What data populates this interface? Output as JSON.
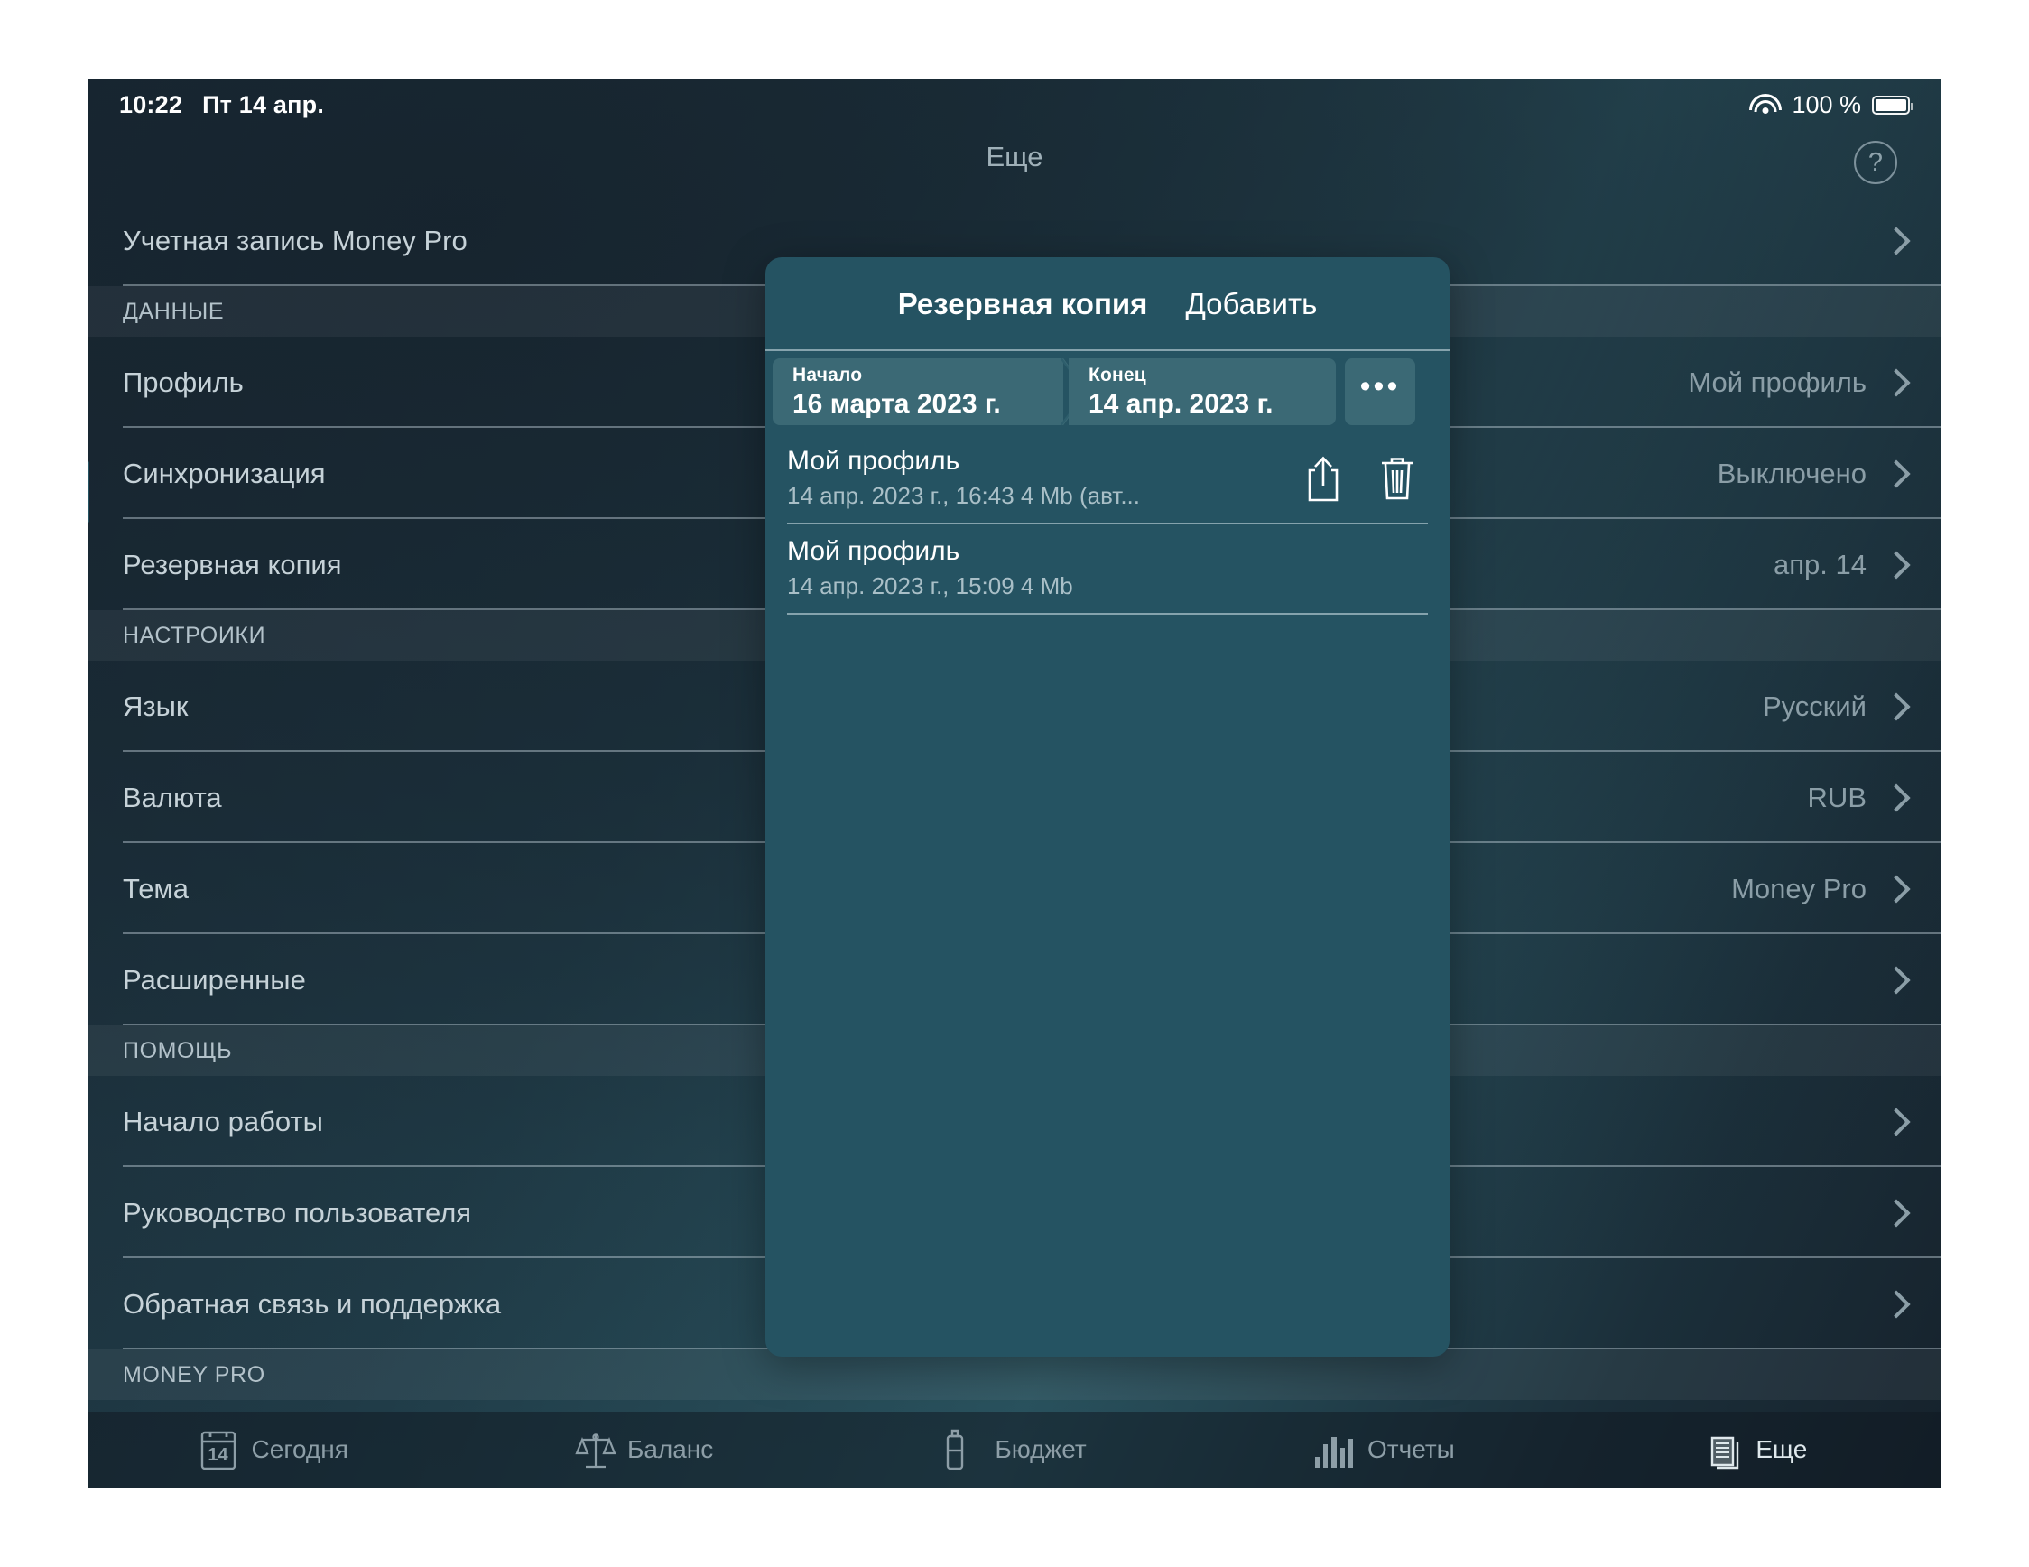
{
  "statusbar": {
    "time": "10:22",
    "date": "Пт 14 апр.",
    "battery_percent": "100 %",
    "wifi_icon": "wifi-icon",
    "battery_icon": "battery-full-icon"
  },
  "header": {
    "title": "Еще",
    "help_icon": "question-mark-icon"
  },
  "settings": {
    "rows": [
      {
        "type": "row",
        "label": "Учетная запись Money Pro",
        "value": ""
      },
      {
        "type": "section",
        "label": "ДАННЫЕ"
      },
      {
        "type": "row",
        "label": "Профиль",
        "value": "Мой профиль"
      },
      {
        "type": "row",
        "label": "Синхронизация",
        "value": "Выключено"
      },
      {
        "type": "row",
        "label": "Резервная копия",
        "value": "апр. 14"
      },
      {
        "type": "section",
        "label": "НАСТРОИКИ"
      },
      {
        "type": "row",
        "label": "Язык",
        "value": "Русский"
      },
      {
        "type": "row",
        "label": "Валюта",
        "value": "RUB"
      },
      {
        "type": "row",
        "label": "Тема",
        "value": "Money Pro"
      },
      {
        "type": "row",
        "label": "Расширенные",
        "value": ""
      },
      {
        "type": "section",
        "label": "ПОМОЩЬ"
      },
      {
        "type": "row",
        "label": "Начало работы",
        "value": ""
      },
      {
        "type": "row",
        "label": "Руководство пользователя",
        "value": ""
      },
      {
        "type": "row",
        "label": "Обратная связь и поддержка",
        "value": ""
      },
      {
        "type": "section",
        "label": "MONEY PRO"
      }
    ]
  },
  "popover": {
    "title": "Резервная копия",
    "add_label": "Добавить",
    "range": {
      "start_caption": "Начало",
      "start_value": "16 марта 2023 г.",
      "end_caption": "Конец",
      "end_value": "14 апр. 2023 г.",
      "more_label": "•••",
      "more_icon": "ellipsis-icon"
    },
    "backups": [
      {
        "name": "Мой профиль",
        "meta": "14 апр. 2023 г., 16:43 4 Mb  (авт...",
        "share_icon": "share-icon",
        "delete_icon": "trash-icon",
        "has_actions": true
      },
      {
        "name": "Мой профиль",
        "meta": "14 апр. 2023 г., 15:09 4 Mb",
        "has_actions": false
      }
    ]
  },
  "tabbar": {
    "tabs": [
      {
        "label": "Сегодня",
        "icon": "calendar-icon",
        "day": "14",
        "active": false
      },
      {
        "label": "Баланс",
        "icon": "scales-icon",
        "active": false
      },
      {
        "label": "Бюджет",
        "icon": "budget-icon",
        "active": false
      },
      {
        "label": "Отчеты",
        "icon": "bar-chart-icon",
        "active": false
      },
      {
        "label": "Еще",
        "icon": "documents-icon",
        "active": true
      }
    ]
  },
  "colors": {
    "popover_bg": "#255362",
    "segment_bg": "#3b6975",
    "page_bg_dark": "#17242e",
    "page_bg_teal": "#2a535f",
    "text_primary": "#ffffff",
    "text_secondary": "#8b9ea7"
  }
}
